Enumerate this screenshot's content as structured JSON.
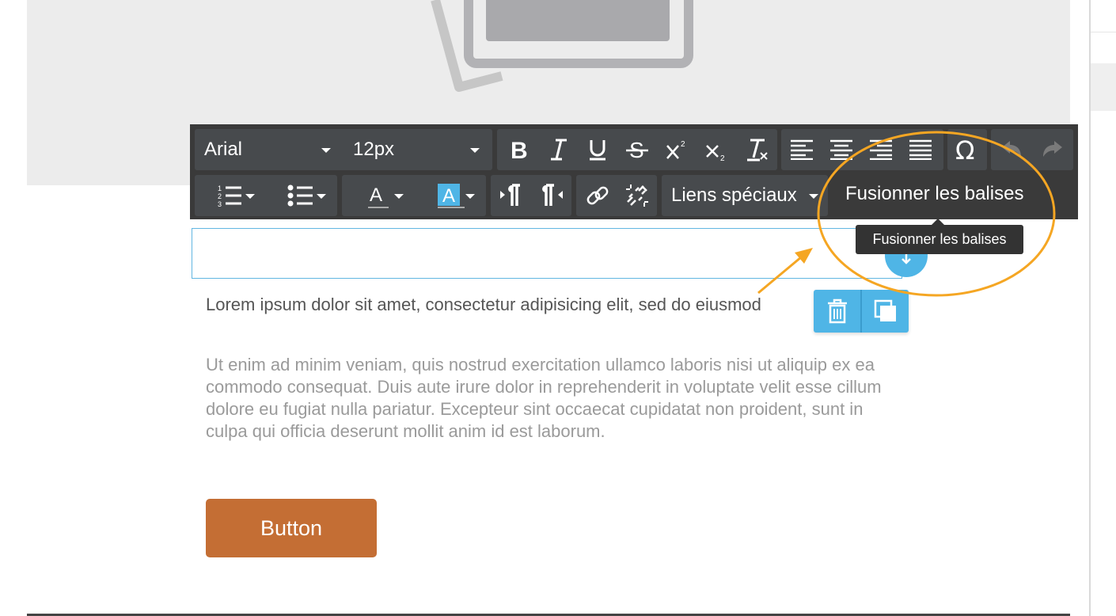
{
  "toolbar": {
    "font_family": "Arial",
    "font_size": "12px",
    "special_links_label": "Liens spéciaux",
    "merge_tags_label": "Fusionner les balises"
  },
  "tooltip": {
    "text": "Fusionner les balises"
  },
  "content": {
    "paragraph1": "Lorem ipsum dolor sit amet, consectetur adipisicing elit, sed do eiusmod",
    "paragraph2": "Ut enim ad minim veniam, quis nostrud exercitation ullamco laboris nisi ut aliquip ex ea commodo consequat. Duis aute irure dolor in reprehenderit in voluptate velit esse cillum dolore eu fugiat nulla pariatur. Excepteur sint occaecat cupidatat non proident, sunt in culpa qui officia deserunt mollit anim id est laborum.",
    "button_label": "Button"
  },
  "icons": {
    "image_placeholder": "image-placeholder-icon",
    "bold": "bold-icon",
    "italic": "italic-icon",
    "underline": "underline-icon",
    "strikethrough": "strikethrough-icon",
    "superscript": "superscript-icon",
    "subscript": "subscript-icon",
    "clear_format": "clear-format-icon",
    "align_left": "align-left-icon",
    "align_center": "align-center-icon",
    "align_right": "align-right-icon",
    "align_justify": "align-justify-icon",
    "special_char": "omega-icon",
    "undo": "undo-icon",
    "redo": "redo-icon",
    "ordered_list": "ordered-list-icon",
    "unordered_list": "unordered-list-icon",
    "text_color": "text-color-icon",
    "background_color": "background-color-icon",
    "ltr": "paragraph-ltr-icon",
    "rtl": "paragraph-rtl-icon",
    "link": "link-icon",
    "unlink": "unlink-icon",
    "delete": "trash-icon",
    "duplicate": "duplicate-icon",
    "drag": "drag-handle-icon"
  },
  "colors": {
    "toolbar_bg": "#3a3a3a",
    "accent_blue": "#4fb5e6",
    "button_bg": "#c46e34",
    "annotation_orange": "#f5a623"
  }
}
